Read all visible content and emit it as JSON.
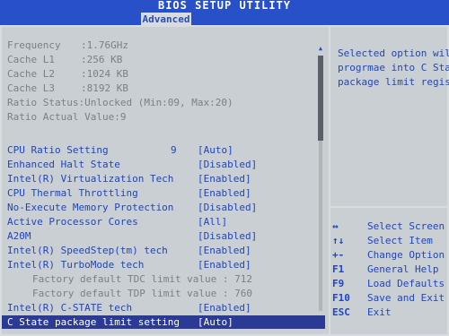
{
  "title_bar": {
    "app_title": "BIOS SETUP UTILITY",
    "active_tab": "Advanced"
  },
  "info": [
    {
      "label": "Frequency",
      "value": ":1.76GHz"
    },
    {
      "label": "Cache L1",
      "value": ":256 KB"
    },
    {
      "label": "Cache L2",
      "value": ":1024 KB"
    },
    {
      "label": "Cache L3",
      "value": ":8192 KB"
    },
    {
      "label": "Ratio Status:Unlocked (Min:09, Max:20)",
      "value": ""
    },
    {
      "label": "Ratio Actual Value:9",
      "value": ""
    }
  ],
  "settings": [
    {
      "label": "CPU Ratio Setting",
      "num": "9",
      "value": "[Auto]"
    },
    {
      "label": "Enhanced Halt State",
      "num": "",
      "value": "[Disabled]"
    },
    {
      "label": "Intel(R) Virtualization Tech",
      "num": "",
      "value": "[Enabled]"
    },
    {
      "label": "CPU Thermal Throttling",
      "num": "",
      "value": "[Enabled]"
    },
    {
      "label": "No-Execute Memory Protection",
      "num": "",
      "value": "[Disabled]"
    },
    {
      "label": "Active Processor Cores",
      "num": "",
      "value": "[All]"
    },
    {
      "label": "A20M",
      "num": "",
      "value": "[Disabled]"
    },
    {
      "label": "Intel(R) SpeedStep(tm) tech",
      "num": "",
      "value": "[Enabled]"
    },
    {
      "label": "Intel(R) TurboMode tech",
      "num": "",
      "value": "[Enabled]"
    }
  ],
  "factory": [
    "Factory default TDC limit value : 712",
    "Factory default TDP limit value : 760"
  ],
  "more_settings": [
    {
      "label": "Intel(R) C-STATE tech",
      "value": "[Enabled]"
    }
  ],
  "selected_setting": {
    "label": "C State package limit setting",
    "value": "[Auto]"
  },
  "help": {
    "lines": [
      "Selected option wil",
      "progrmae into C Sta",
      "package limit regis"
    ]
  },
  "keys": [
    {
      "key": "↔",
      "desc": "Select Screen"
    },
    {
      "key": "↑↓",
      "desc": "Select Item"
    },
    {
      "key": "+-",
      "desc": "Change Option"
    },
    {
      "key": "F1",
      "desc": "General Help"
    },
    {
      "key": "F9",
      "desc": "Load Defaults"
    },
    {
      "key": "F10",
      "desc": "Save and Exit"
    },
    {
      "key": "ESC",
      "desc": "Exit"
    }
  ]
}
